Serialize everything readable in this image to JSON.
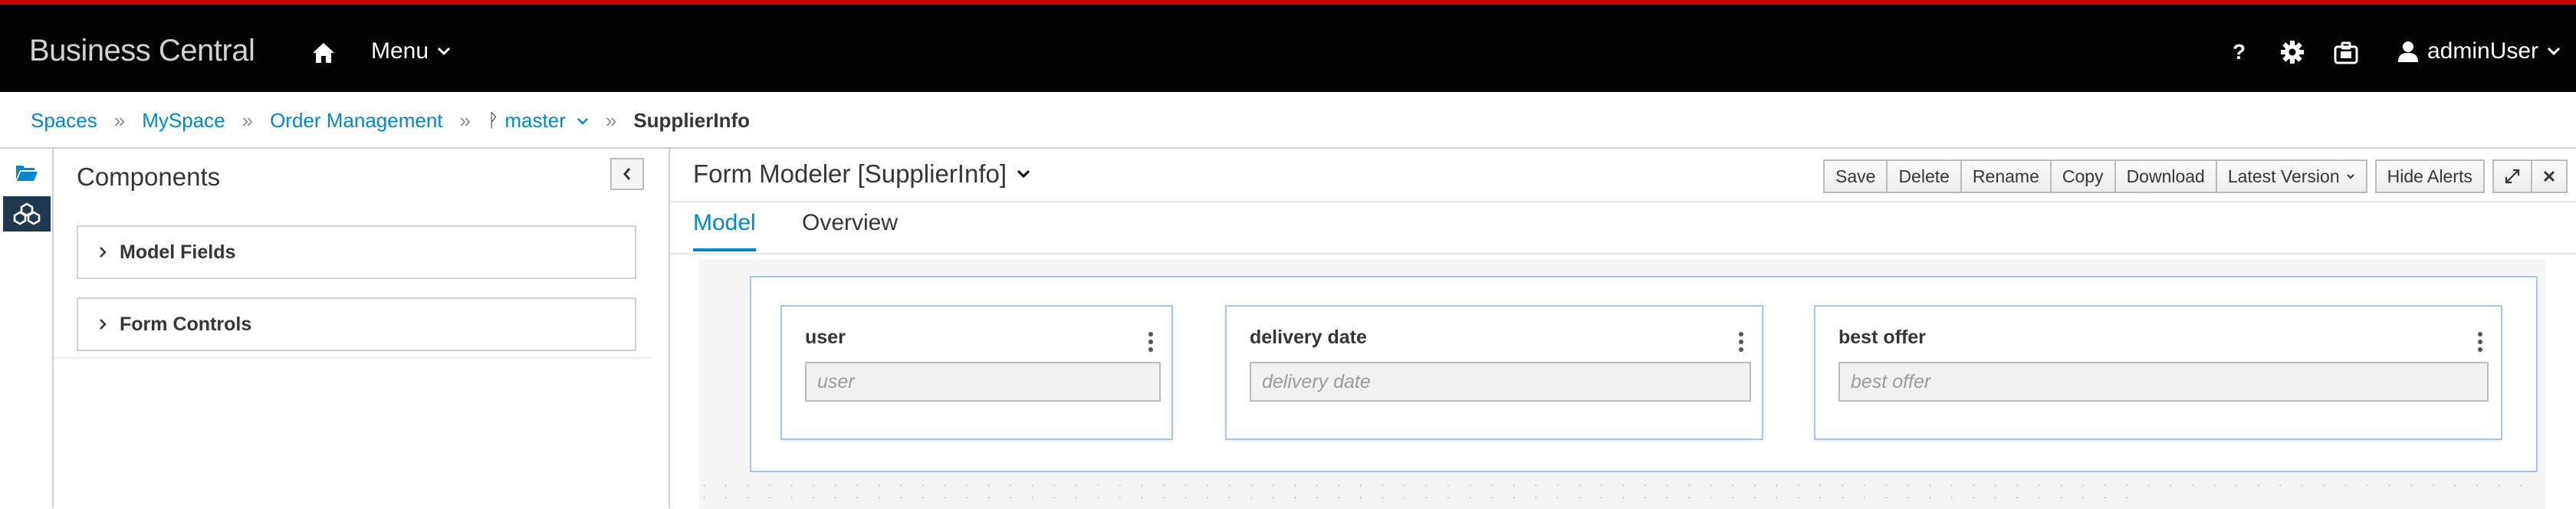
{
  "navbar": {
    "brand": "Business Central",
    "menu_label": "Menu",
    "help_label": "?",
    "user_label": "adminUser"
  },
  "breadcrumb": {
    "items": [
      "Spaces",
      "MySpace",
      "Order Management",
      "master"
    ],
    "current": "SupplierInfo",
    "separator": "»",
    "branch_symbol": "ᚹ"
  },
  "components": {
    "title": "Components",
    "sections": [
      "Model Fields",
      "Form Controls"
    ]
  },
  "editor": {
    "title": "Form Modeler [SupplierInfo]",
    "toolbar": {
      "save": "Save",
      "delete": "Delete",
      "rename": "Rename",
      "copy": "Copy",
      "download": "Download",
      "latest_version": "Latest Version",
      "hide_alerts": "Hide Alerts"
    },
    "tabs": [
      "Model",
      "Overview"
    ],
    "active_tab": "Model"
  },
  "form": {
    "fields": [
      {
        "label": "user",
        "placeholder": "user"
      },
      {
        "label": "delivery date",
        "placeholder": "delivery date"
      },
      {
        "label": "best offer",
        "placeholder": "best offer"
      }
    ]
  },
  "colors": {
    "accent": "#0088ce",
    "navbar_bg": "#030303",
    "navbar_top_border": "#cc0000",
    "field_border": "#a7c7e8"
  },
  "icons": [
    "home-icon",
    "chevron-down-icon",
    "help-icon",
    "gear-icon",
    "briefcase-icon",
    "user-icon",
    "folder-open-icon",
    "cubes-icon",
    "chevron-left-icon",
    "chevron-right-icon",
    "expand-icon",
    "close-icon",
    "kebab-icon",
    "branch-icon"
  ]
}
